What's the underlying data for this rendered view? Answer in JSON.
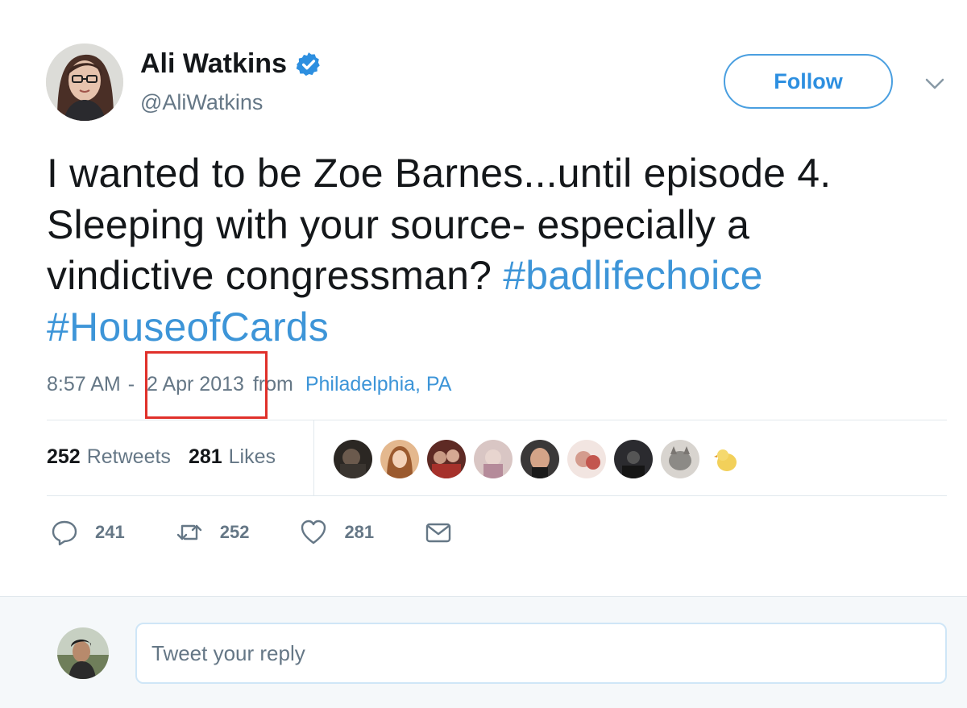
{
  "author": {
    "name": "Ali Watkins",
    "handle": "@AliWatkins",
    "verified_icon": "verified-badge-icon",
    "avatar": "author-avatar"
  },
  "header": {
    "follow_label": "Follow",
    "more_icon": "chevron-down-icon"
  },
  "tweet": {
    "lines": [
      {
        "text": "I wanted to be Zoe Barnes...until episode 4."
      },
      {
        "text": "Sleeping with your source- especially a"
      },
      {
        "text": "vindictive congressman? ",
        "hashtag": "#badlifechoice"
      },
      {
        "hashtag": "#HouseofCards"
      }
    ]
  },
  "meta": {
    "time": "8:57 AM",
    "separator": "-",
    "date": "2 Apr 2013",
    "from_label": "from",
    "location": "Philadelphia, PA"
  },
  "stats": {
    "retweets_count": "252",
    "retweets_label": "Retweets",
    "likes_count": "281",
    "likes_label": "Likes"
  },
  "likers_count_shown": 9,
  "actions": {
    "reply_count": "241",
    "retweet_count": "252",
    "like_count": "281"
  },
  "reply": {
    "placeholder": "Tweet your reply"
  },
  "colors": {
    "accent": "#3d95d8",
    "highlight_box": "#e0302a",
    "muted": "#657786",
    "text": "#14171a"
  }
}
